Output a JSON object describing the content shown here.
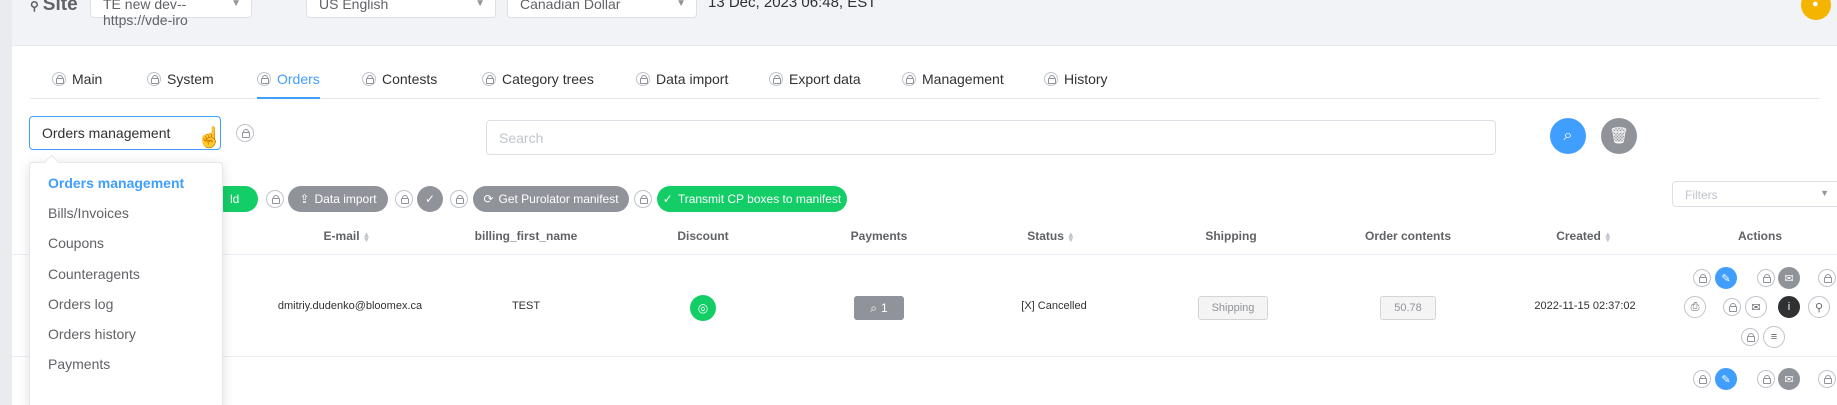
{
  "topbar": {
    "site_label": "Site",
    "site_select": "TE new dev--https://vde-iro",
    "language_select": "US English",
    "currency_select": "Canadian Dollar",
    "datetime": "13 Dec, 2023 06:48, EST"
  },
  "tabs": [
    {
      "label": "Main"
    },
    {
      "label": "System"
    },
    {
      "label": "Orders",
      "active": true
    },
    {
      "label": "Contests"
    },
    {
      "label": "Category trees"
    },
    {
      "label": "Data import"
    },
    {
      "label": "Export data"
    },
    {
      "label": "Management"
    },
    {
      "label": "History"
    }
  ],
  "module_select": {
    "value": "Orders management"
  },
  "dropdown": {
    "items": [
      "Orders management",
      "Bills/Invoices",
      "Coupons",
      "Counteragents",
      "Orders log",
      "Orders history",
      "Payments"
    ],
    "selected": "Orders management"
  },
  "search": {
    "placeholder": "Search",
    "value": ""
  },
  "action_buttons": {
    "partial_add": "ld",
    "data_import": "Data import",
    "get_purolator_manifest": "Get Purolator manifest",
    "transmit_cp": "Transmit CP boxes to manifest"
  },
  "filters": {
    "placeholder": "Filters"
  },
  "table": {
    "headers": [
      "E-mail",
      "billing_first_name",
      "Discount",
      "Payments",
      "Status",
      "Shipping",
      "Order contents",
      "Created",
      "Actions"
    ],
    "rows": [
      {
        "email": "dmitriy.dudenko@bloomex.ca",
        "billing_first_name": "TEST",
        "payments_count": "1",
        "status": "[X] Cancelled",
        "shipping": "Shipping",
        "order_contents": "50.78",
        "created": "2022-11-15 02:37:02"
      }
    ]
  },
  "colors": {
    "primary": "#409eff",
    "success": "#13ce66",
    "gray": "#909399",
    "avatar": "#f5b400"
  }
}
